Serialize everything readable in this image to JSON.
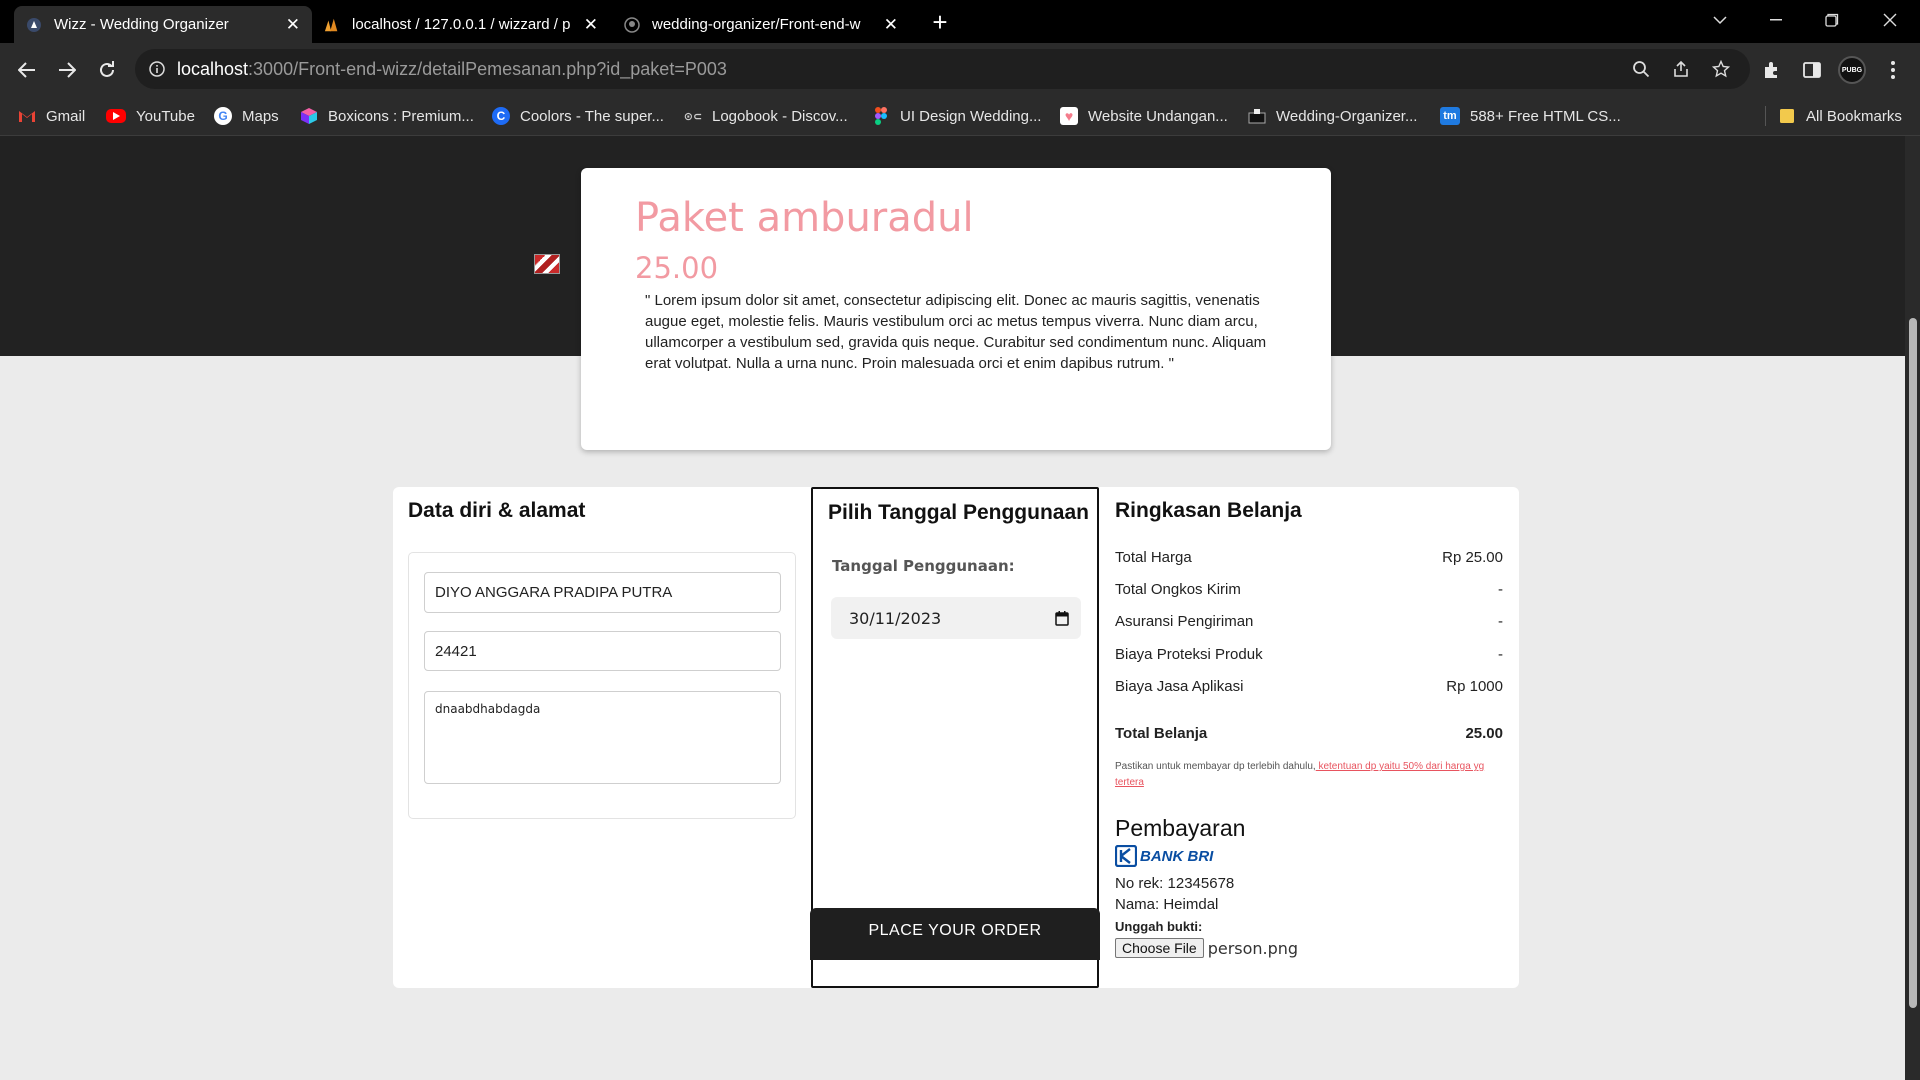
{
  "browser": {
    "tabs": [
      {
        "title": "Wizz - Wedding Organizer",
        "active": true
      },
      {
        "title": "localhost / 127.0.0.1 / wizzard / p",
        "active": false
      },
      {
        "title": "wedding-organizer/Front-end-w",
        "active": false
      }
    ],
    "new_tab_label": "+",
    "url_host": "localhost",
    "url_path": ":3000/Front-end-wizz/detailPemesanan.php?id_paket=P003",
    "profile_badge": "PUBG",
    "bookmarks": [
      {
        "label": "Gmail",
        "icon": "gmail-icon",
        "color": "#ea4335"
      },
      {
        "label": "YouTube",
        "icon": "youtube-icon",
        "color": "#ff0000"
      },
      {
        "label": "Maps",
        "icon": "google-icon",
        "color": "#4285f4"
      },
      {
        "label": "Boxicons : Premium...",
        "icon": "boxicons-icon",
        "color": "#e0398c"
      },
      {
        "label": "Coolors - The super...",
        "icon": "coolors-icon",
        "color": "#1e6bf5"
      },
      {
        "label": "Logobook - Discov...",
        "icon": "logobook-icon",
        "color": "#cccccc"
      },
      {
        "label": "UI Design Wedding...",
        "icon": "figma-icon",
        "color": "#a259ff"
      },
      {
        "label": "Website Undangan...",
        "icon": "heart-icon",
        "color": "#f47c8c"
      },
      {
        "label": "Wedding-Organizer...",
        "icon": "folder-dark-icon",
        "color": "#cccccc"
      },
      {
        "label": "588+ Free HTML CS...",
        "icon": "tm-icon",
        "color": "#1f7ae0"
      }
    ],
    "all_bookmarks_label": "All Bookmarks"
  },
  "package": {
    "title": "Paket amburadul",
    "price": "25.00",
    "description": "\" Lorem ipsum dolor sit amet, consectetur adipiscing elit. Donec ac mauris sagittis, venenatis augue eget, molestie felis. Mauris vestibulum orci ac metus tempus viverra. Nunc diam arcu, ullamcorper a vestibulum sed, gravida quis neque. Curabitur sed condimentum nunc. Aliquam erat volutpat. Nulla a urna nunc. Proin malesuada orci et enim dapibus rutrum. \""
  },
  "personal": {
    "heading": "Data diri & alamat",
    "name_value": "DIYO ANGGARA PRADIPA PUTRA",
    "postcode_value": "24421",
    "address_value": "dnaabdhabdagda"
  },
  "date_section": {
    "heading": "Pilih Tanggal Penggunaan",
    "label": "Tanggal Penggunaan:",
    "value": "30/11/2023"
  },
  "summary": {
    "heading": "Ringkasan Belanja",
    "rows": [
      {
        "label": "Total Harga",
        "value": "Rp 25.00"
      },
      {
        "label": "Total Ongkos Kirim",
        "value": "-"
      },
      {
        "label": "Asuransi Pengiriman",
        "value": "-"
      },
      {
        "label": "Biaya Proteksi Produk",
        "value": "-"
      },
      {
        "label": "Biaya Jasa Aplikasi",
        "value": "Rp 1000"
      }
    ],
    "total_label": "Total Belanja",
    "total_value": "25.00",
    "dp_note_text": "Pastikan untuk membayar dp terlebih dahulu,",
    "dp_note_link": " ketentuan dp yaitu 50% dari harga yg tertera "
  },
  "payment": {
    "heading": "Pembayaran",
    "bank_name": "BANK BRI",
    "account_number": "No rek: 12345678",
    "account_name": "Nama: Heimdal",
    "upload_label": "Unggah bukti:",
    "file_button": "Choose File",
    "file_name": "person.png"
  },
  "order_button": "PLACE YOUR ORDER",
  "colors": {
    "accent_pink": "#f29aa2",
    "link_red": "#e8545f",
    "bri_blue": "#0a4ea2",
    "dark_header": "#222222"
  }
}
